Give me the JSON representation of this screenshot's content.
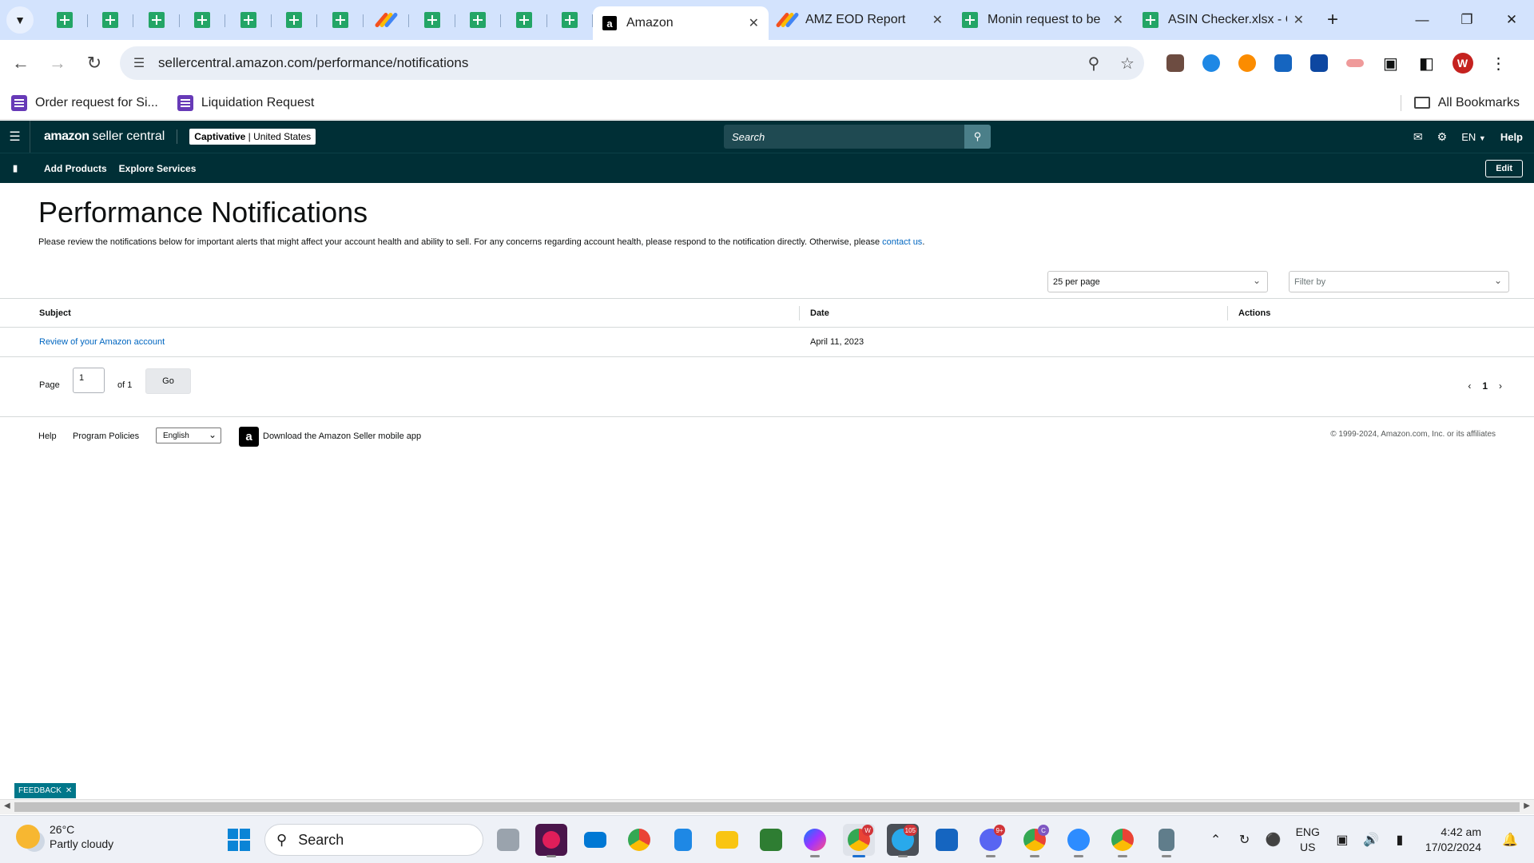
{
  "browser": {
    "tabs": [
      {
        "title": "Amazon",
        "active": true,
        "favicon": "amazon-icon"
      },
      {
        "title": "AMZ EOD Report",
        "active": false,
        "favicon": "stroke-icon"
      },
      {
        "title": "Monin request to be",
        "active": false,
        "favicon": "sheets-icon"
      },
      {
        "title": "ASIN Checker.xlsx - G",
        "active": false,
        "favicon": "sheets-icon"
      }
    ],
    "url": "sellercentral.amazon.com/performance/notifications",
    "profile_initial": "W",
    "bookmarks": [
      {
        "label": "Order request for Si..."
      },
      {
        "label": "Liquidation Request"
      }
    ],
    "all_bookmarks_label": "All Bookmarks"
  },
  "seller_central": {
    "logo_bold": "amazon",
    "logo_rest": "seller central",
    "account_name": "Captivative",
    "account_region": "United States",
    "search_placeholder": "Search",
    "language": "EN",
    "help_label": "Help",
    "subnav": [
      "Add Products",
      "Explore Services"
    ],
    "edit_label": "Edit"
  },
  "page": {
    "title": "Performance Notifications",
    "description": "Please review the notifications below for important alerts that might affect your account health and ability to sell. For any concerns regarding account health, please respond to the notification directly. Otherwise, please ",
    "contact_link": "contact us",
    "description_end": ".",
    "per_page": "25 per page",
    "filter_placeholder": "Filter by",
    "table": {
      "headers": [
        "Subject",
        "Date",
        "Actions"
      ],
      "rows": [
        {
          "subject": "Review of your Amazon account",
          "date": "April 11, 2023",
          "actions": ""
        }
      ]
    },
    "pager": {
      "page_label": "Page",
      "page_value": "1",
      "of_label": "of 1",
      "go_label": "Go",
      "current": "1"
    }
  },
  "footer": {
    "help": "Help",
    "policies": "Program Policies",
    "language": "English",
    "app_link": "Download the Amazon Seller mobile app",
    "copyright": "© 1999-2024, Amazon.com, Inc. or its affiliates"
  },
  "feedback_label": "FEEDBACK",
  "taskbar": {
    "temperature": "26°C",
    "weather": "Partly cloudy",
    "search_label": "Search",
    "lang_top": "ENG",
    "lang_bottom": "US",
    "time": "4:42 am",
    "date": "17/02/2024",
    "badges": {
      "chrome": "W",
      "telegram": "105",
      "discord": "9+",
      "chrome2": "C"
    }
  },
  "colors": {
    "sc_header": "#002f36",
    "link": "#0066c0",
    "tabstrip": "#d3e3fd",
    "feedback": "#00778a"
  }
}
